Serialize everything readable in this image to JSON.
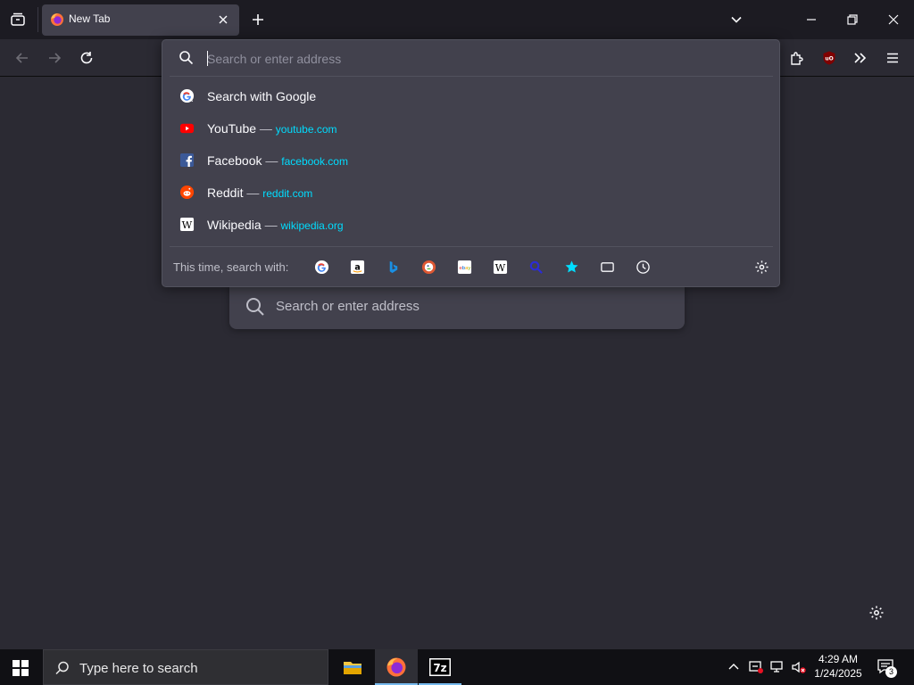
{
  "tab": {
    "title": "New Tab"
  },
  "urlbar": {
    "placeholder": "Search or enter address",
    "rows": [
      {
        "label": "Search with Google",
        "icon": "google-icon"
      },
      {
        "label": "YouTube",
        "url": "youtube.com",
        "icon": "youtube-icon"
      },
      {
        "label": "Facebook",
        "url": "facebook.com",
        "icon": "facebook-icon"
      },
      {
        "label": "Reddit",
        "url": "reddit.com",
        "icon": "reddit-icon"
      },
      {
        "label": "Wikipedia",
        "url": "wikipedia.org",
        "icon": "wikipedia-icon"
      }
    ],
    "dash": "—",
    "search_with_label": "This time, search with:",
    "engines": [
      "google-icon",
      "amazon-icon",
      "bing-icon",
      "duckduckgo-icon",
      "ebay-icon",
      "wikipedia-icon",
      "search-icon",
      "bookmarks-star-icon",
      "tabs-icon",
      "history-icon"
    ]
  },
  "page": {
    "search_placeholder": "Search or enter address"
  },
  "taskbar": {
    "search_placeholder": "Type here to search",
    "time": "4:29 AM",
    "date": "1/24/2025",
    "notification_count": "3"
  },
  "colors": {
    "accent": "#00ddff",
    "panel": "#42414d",
    "background": "#2b2a33"
  }
}
